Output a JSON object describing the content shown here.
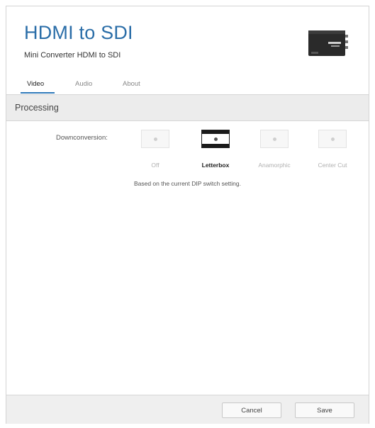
{
  "header": {
    "title": "HDMI to SDI",
    "subtitle": "Mini Converter HDMI to SDI",
    "device_image": "converter-device-icon"
  },
  "tabs": [
    {
      "label": "Video",
      "active": true
    },
    {
      "label": "Audio",
      "active": false
    },
    {
      "label": "About",
      "active": false
    }
  ],
  "section": {
    "title": "Processing"
  },
  "downconversion": {
    "label": "Downconversion:",
    "options": [
      {
        "label": "Off",
        "selected": false
      },
      {
        "label": "Letterbox",
        "selected": true
      },
      {
        "label": "Anamorphic",
        "selected": false
      },
      {
        "label": "Center Cut",
        "selected": false
      }
    ],
    "note": "Based on the current DIP switch setting."
  },
  "footer": {
    "cancel_label": "Cancel",
    "save_label": "Save"
  },
  "colors": {
    "title_blue": "#2b6ea8",
    "tab_underline": "#2e79b9",
    "section_bg": "#ececec"
  }
}
